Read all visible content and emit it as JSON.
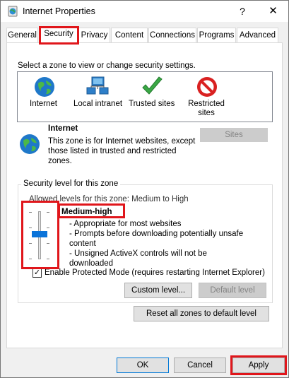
{
  "window": {
    "title": "Internet Properties",
    "help_label": "?",
    "close_label": "✕"
  },
  "tabs": [
    {
      "label": "General",
      "active": false
    },
    {
      "label": "Security",
      "active": true
    },
    {
      "label": "Privacy",
      "active": false
    },
    {
      "label": "Content",
      "active": false
    },
    {
      "label": "Connections",
      "active": false
    },
    {
      "label": "Programs",
      "active": false
    },
    {
      "label": "Advanced",
      "active": false
    }
  ],
  "zones": {
    "prompt": "Select a zone to view or change security settings.",
    "items": [
      {
        "label": "Internet",
        "icon": "globe-icon",
        "selected": true
      },
      {
        "label": "Local intranet",
        "icon": "network-icon",
        "selected": false
      },
      {
        "label": "Trusted sites",
        "icon": "checkmark-icon",
        "selected": false
      },
      {
        "label": "Restricted sites",
        "icon": "restricted-icon",
        "selected": false
      }
    ]
  },
  "zone_info": {
    "title": "Internet",
    "description": "This zone is for Internet websites, except those listed in trusted and restricted zones.",
    "sites_button": "Sites"
  },
  "security_level": {
    "group_label": "Security level for this zone",
    "allowed": "Allowed levels for this zone: Medium to High",
    "level_name": "Medium-high",
    "level_lines": [
      "- Appropriate for most websites",
      "- Prompts before downloading potentially unsafe content",
      "- Unsigned ActiveX controls will not be downloaded"
    ],
    "slider_level_index": 2,
    "slider_level_count": 4,
    "protected_mode_label": "Enable Protected Mode (requires restarting Internet Explorer)",
    "protected_mode_checked": true,
    "custom_level_button": "Custom level...",
    "default_level_button": "Default level"
  },
  "reset_button": "Reset all zones to default level",
  "footer": {
    "ok": "OK",
    "cancel": "Cancel",
    "apply": "Apply"
  },
  "colors": {
    "highlight": "#e0161b",
    "slider_thumb": "#0a73d9"
  }
}
